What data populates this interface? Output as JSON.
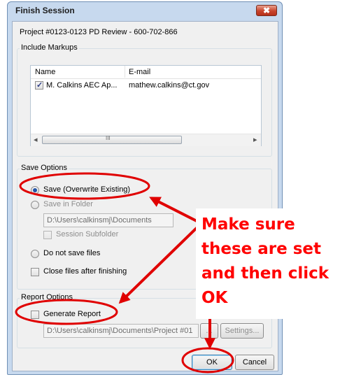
{
  "window": {
    "title": "Finish Session",
    "close_glyph": "✖"
  },
  "project_line": "Project #0123-0123 PD Review - 600-702-866",
  "markups": {
    "group_label": "Include Markups",
    "columns": [
      "Name",
      "E-mail"
    ],
    "rows": [
      {
        "checked": true,
        "name": "M. Calkins AEC Ap...",
        "email": "mathew.calkins@ct.gov"
      }
    ],
    "scroll_left": "◂",
    "scroll_right": "▸",
    "scroll_grip": "III"
  },
  "save_options": {
    "group_label": "Save Options",
    "save_overwrite": "Save (Overwrite Existing)",
    "save_in_folder": "Save in Folder",
    "folder_path": "D:\\Users\\calkinsmj\\Documents",
    "session_subfolder": "Session Subfolder",
    "do_not_save": "Do not save files",
    "close_files": "Close files after finishing"
  },
  "report_options": {
    "group_label": "Report Options",
    "generate_report": "Generate Report",
    "report_path": "D:\\Users\\calkinsmj\\Documents\\Project #01",
    "browse_label": "...",
    "settings_label": "Settings..."
  },
  "buttons": {
    "ok": "OK",
    "cancel": "Cancel"
  },
  "annotation": {
    "lines": [
      "Make sure",
      "these are set",
      "and then click",
      "OK"
    ],
    "color": "#ff0000"
  }
}
